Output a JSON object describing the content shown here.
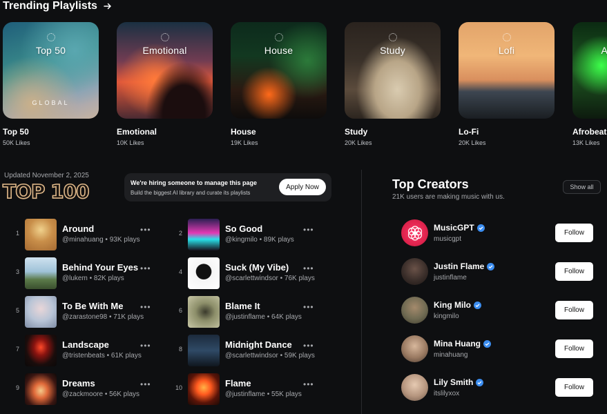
{
  "header": {
    "title": "Trending Playlists"
  },
  "playlists": [
    {
      "cover_label": "Top 50",
      "cover_sub": "GLOBAL",
      "name": "Top 50",
      "likes": "50K Likes"
    },
    {
      "cover_label": "Emotional",
      "cover_sub": "",
      "name": "Emotional",
      "likes": "10K Likes"
    },
    {
      "cover_label": "House",
      "cover_sub": "",
      "name": "House",
      "likes": "19K Likes"
    },
    {
      "cover_label": "Study",
      "cover_sub": "",
      "name": "Study",
      "likes": "20K Likes"
    },
    {
      "cover_label": "Lofi",
      "cover_sub": "",
      "name": "Lo-Fi",
      "likes": "20K Likes"
    },
    {
      "cover_label": "A",
      "cover_sub": "",
      "name": "Afrobeat",
      "likes": "13K Likes"
    }
  ],
  "top100": {
    "updated": "Updated November 2, 2025",
    "title": "TOP 100",
    "hiring_title": "We're hiring someone to manage this page",
    "hiring_sub": "Build the biggest AI library and curate its playlists",
    "apply_label": "Apply Now",
    "more_icon": "ellipsis-icon",
    "tracks": [
      {
        "rank": "1",
        "title": "Around",
        "meta": "@minahuang • 93K plays"
      },
      {
        "rank": "2",
        "title": "So Good",
        "meta": "@kingmilo • 89K plays"
      },
      {
        "rank": "3",
        "title": "Behind Your Eyes",
        "meta": "@lukem • 82K plays"
      },
      {
        "rank": "4",
        "title": "Suck (My Vibe)",
        "meta": "@scarlettwindsor • 76K plays"
      },
      {
        "rank": "5",
        "title": "To Be With Me",
        "meta": "@zarastone98 • 71K plays"
      },
      {
        "rank": "6",
        "title": "Blame It",
        "meta": "@justinflame • 64K plays"
      },
      {
        "rank": "7",
        "title": "Landscape",
        "meta": "@tristenbeats • 61K plays"
      },
      {
        "rank": "8",
        "title": "Midnight Dance",
        "meta": "@scarlettwindsor • 59K plays"
      },
      {
        "rank": "9",
        "title": "Dreams",
        "meta": "@zackmoore • 56K plays"
      },
      {
        "rank": "10",
        "title": "Flame",
        "meta": "@justinflame • 55K plays"
      }
    ]
  },
  "creators": {
    "title": "Top Creators",
    "subtitle": "21K users are making music with us.",
    "show_all": "Show all",
    "follow_label": "Follow",
    "verified_color": "#3b8df0",
    "list": [
      {
        "name": "MusicGPT",
        "handle": "musicgpt"
      },
      {
        "name": "Justin Flame",
        "handle": "justinflame"
      },
      {
        "name": "King Milo",
        "handle": "kingmilo"
      },
      {
        "name": "Mina Huang",
        "handle": "minahuang"
      },
      {
        "name": "Lily Smith",
        "handle": "itslilyxox"
      }
    ]
  }
}
